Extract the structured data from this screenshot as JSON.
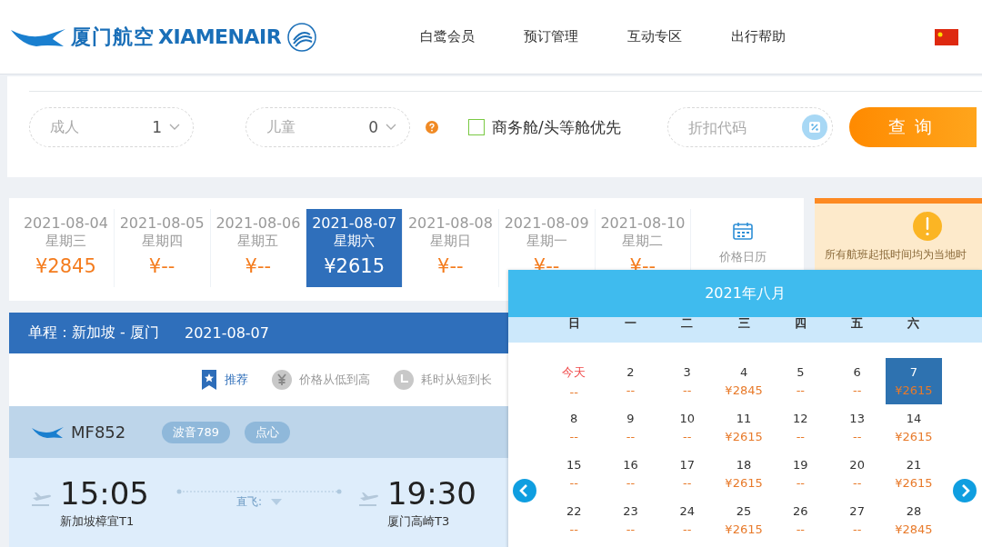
{
  "header": {
    "logo_cn": "厦门航空",
    "logo_en": "XIAMENAIR",
    "nav": [
      "白鹭会员",
      "预订管理",
      "互动专区",
      "出行帮助"
    ]
  },
  "search": {
    "adults": {
      "label": "成人",
      "value": "1"
    },
    "children": {
      "label": "儿童",
      "value": "0"
    },
    "cabin_option": {
      "label": "商务舱/头等舱优先",
      "checked": false
    },
    "promo": {
      "placeholder": "折扣代码"
    },
    "submit": "查 询"
  },
  "dates": [
    {
      "date": "2021-08-04",
      "weekday": "星期三",
      "price": "¥2845",
      "selected": false
    },
    {
      "date": "2021-08-05",
      "weekday": "星期四",
      "price": "¥--",
      "selected": false
    },
    {
      "date": "2021-08-06",
      "weekday": "星期五",
      "price": "¥--",
      "selected": false
    },
    {
      "date": "2021-08-07",
      "weekday": "星期六",
      "price": "¥2615",
      "selected": true
    },
    {
      "date": "2021-08-08",
      "weekday": "星期日",
      "price": "¥--",
      "selected": false
    },
    {
      "date": "2021-08-09",
      "weekday": "星期一",
      "price": "¥--",
      "selected": false
    },
    {
      "date": "2021-08-10",
      "weekday": "星期二",
      "price": "¥--",
      "selected": false
    }
  ],
  "price_calendar": "价格日历",
  "notice": "所有航班起抵时间均为当地时",
  "route": {
    "title": "单程：新加坡 - 厦门",
    "date": "2021-08-07"
  },
  "sort": [
    {
      "label": "推荐",
      "selected": true,
      "kind": "star"
    },
    {
      "label": "价格从低到高",
      "selected": false,
      "kind": "yuan"
    },
    {
      "label": "耗时从短到长",
      "selected": false,
      "kind": "clock"
    }
  ],
  "flight": {
    "number": "MF852",
    "tags": [
      "波音789",
      "点心"
    ],
    "depart_time": "15:05",
    "depart_airport": "新加坡樟宜T1",
    "stop": "直飞:",
    "arrive_time": "19:30",
    "arrive_airport": "厦门高崎T3"
  },
  "calendar": {
    "title": "2021年八月",
    "weekdays": [
      "日",
      "一",
      "二",
      "三",
      "四",
      "五",
      "六"
    ],
    "weeks": [
      [
        {
          "day": "今天",
          "price": "--",
          "kind": "today",
          "selected": false
        },
        {
          "day": "2",
          "price": "--",
          "kind": "day",
          "selected": false
        },
        {
          "day": "3",
          "price": "--",
          "kind": "day",
          "selected": false
        },
        {
          "day": "4",
          "price": "¥2845",
          "kind": "day",
          "selected": false
        },
        {
          "day": "5",
          "price": "--",
          "kind": "day",
          "selected": false
        },
        {
          "day": "6",
          "price": "--",
          "kind": "day",
          "selected": false
        },
        {
          "day": "7",
          "price": "¥2615",
          "kind": "day",
          "selected": true
        }
      ],
      [
        {
          "day": "8",
          "price": "--",
          "kind": "day",
          "selected": false
        },
        {
          "day": "9",
          "price": "--",
          "kind": "day",
          "selected": false
        },
        {
          "day": "10",
          "price": "--",
          "kind": "day",
          "selected": false
        },
        {
          "day": "11",
          "price": "¥2615",
          "kind": "day",
          "selected": false
        },
        {
          "day": "12",
          "price": "--",
          "kind": "day",
          "selected": false
        },
        {
          "day": "13",
          "price": "--",
          "kind": "day",
          "selected": false
        },
        {
          "day": "14",
          "price": "¥2615",
          "kind": "day",
          "selected": false
        }
      ],
      [
        {
          "day": "15",
          "price": "--",
          "kind": "day",
          "selected": false
        },
        {
          "day": "16",
          "price": "--",
          "kind": "day",
          "selected": false
        },
        {
          "day": "17",
          "price": "--",
          "kind": "day",
          "selected": false
        },
        {
          "day": "18",
          "price": "¥2615",
          "kind": "day",
          "selected": false
        },
        {
          "day": "19",
          "price": "--",
          "kind": "day",
          "selected": false
        },
        {
          "day": "20",
          "price": "--",
          "kind": "day",
          "selected": false
        },
        {
          "day": "21",
          "price": "¥2615",
          "kind": "day",
          "selected": false
        }
      ],
      [
        {
          "day": "22",
          "price": "--",
          "kind": "day",
          "selected": false
        },
        {
          "day": "23",
          "price": "--",
          "kind": "day",
          "selected": false
        },
        {
          "day": "24",
          "price": "--",
          "kind": "day",
          "selected": false
        },
        {
          "day": "25",
          "price": "¥2615",
          "kind": "day",
          "selected": false
        },
        {
          "day": "26",
          "price": "--",
          "kind": "day",
          "selected": false
        },
        {
          "day": "27",
          "price": "--",
          "kind": "day",
          "selected": false
        },
        {
          "day": "28",
          "price": "¥2845",
          "kind": "day",
          "selected": false
        }
      ]
    ]
  }
}
